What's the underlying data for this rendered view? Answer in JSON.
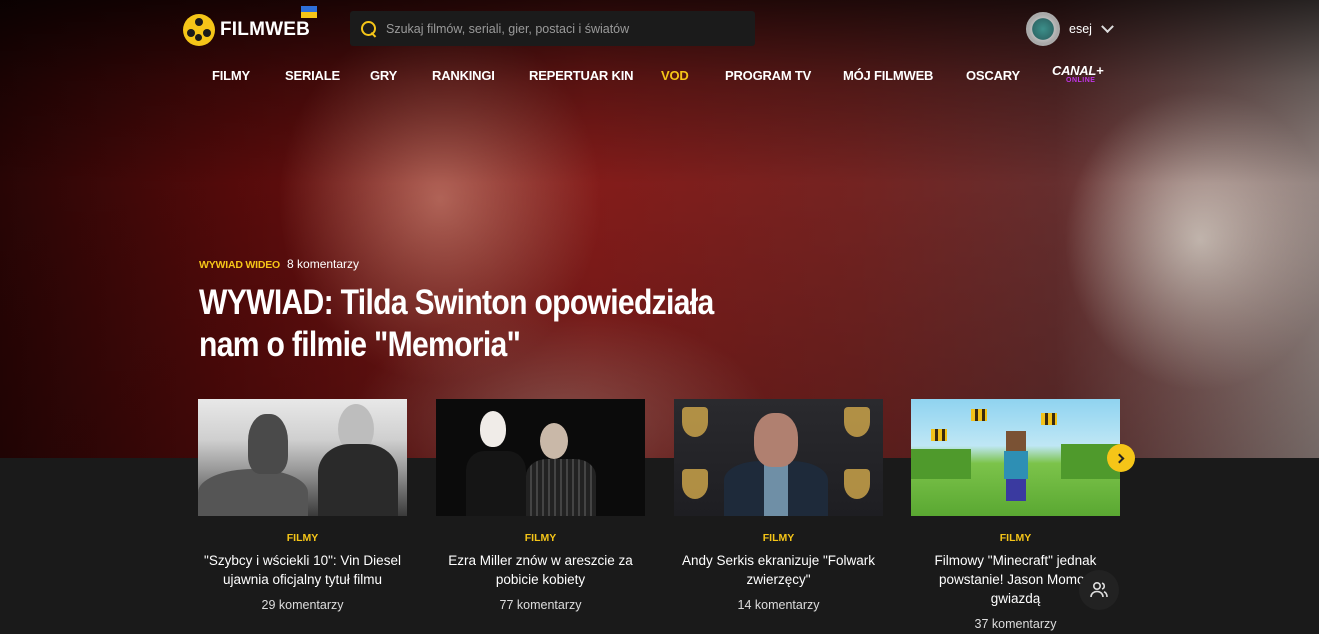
{
  "header": {
    "logo_text": "FILMWEB",
    "search_placeholder": "Szukaj filmów, seriali, gier, postaci i światów",
    "username": "esej"
  },
  "nav": {
    "items": [
      {
        "label": "FILMY",
        "active": false
      },
      {
        "label": "SERIALE",
        "active": false
      },
      {
        "label": "GRY",
        "active": false
      },
      {
        "label": "RANKINGI",
        "active": false
      },
      {
        "label": "REPERTUAR KIN",
        "active": false
      },
      {
        "label": "VOD",
        "active": true
      },
      {
        "label": "PROGRAM TV",
        "active": false
      },
      {
        "label": "MÓJ FILMWEB",
        "active": false
      },
      {
        "label": "OSCARY",
        "active": false
      }
    ],
    "canal_top": "CANAL+",
    "canal_bottom": "ONLINE"
  },
  "hero": {
    "tag": "WYWIAD WIDEO",
    "comments": "8 komentarzy",
    "title_line1": "WYWIAD: Tilda Swinton opowiedziała",
    "title_line2": "nam o filmie \"Memoria\""
  },
  "cards": [
    {
      "category": "FILMY",
      "title": "\"Szybcy i wściekli 10\": Vin Diesel ujawnia oficjalny tytuł filmu",
      "comments": "29 komentarzy"
    },
    {
      "category": "FILMY",
      "title": "Ezra Miller znów w areszcie za pobicie kobiety",
      "comments": "77 komentarzy"
    },
    {
      "category": "FILMY",
      "title": "Andy Serkis ekranizuje \"Folwark zwierzęcy\"",
      "comments": "14 komentarzy"
    },
    {
      "category": "FILMY",
      "title": "Filmowy \"Minecraft\" jednak powstanie! Jason Momoa gwiazdą",
      "comments": "37 komentarzy"
    }
  ],
  "colors": {
    "accent": "#f5c518",
    "canal_online": "#c035e6",
    "background_dark": "#1a1a1a"
  },
  "icons": {
    "search": "search-icon",
    "next": "chevron-right-icon",
    "people": "people-icon",
    "user_menu": "chevron-down-icon"
  }
}
